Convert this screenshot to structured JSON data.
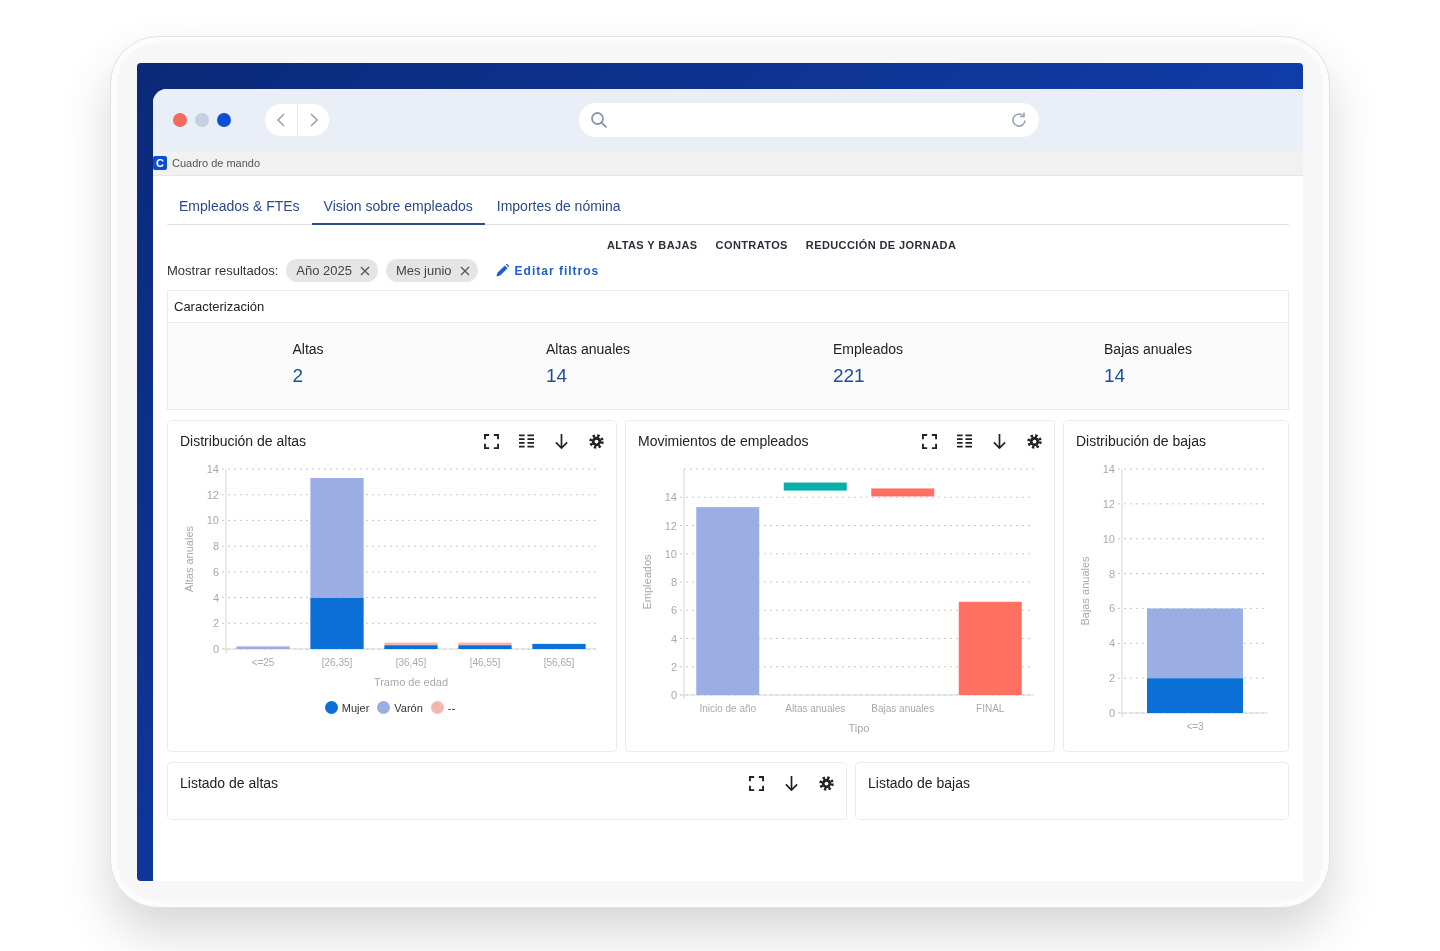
{
  "browser": {
    "tab": {
      "logo": "C",
      "title": "Cuadro de mando"
    }
  },
  "tabs": [
    {
      "label": "Empleados & FTEs",
      "selected": false
    },
    {
      "label": "Vision sobre empleados",
      "selected": true
    },
    {
      "label": "Importes de nómina",
      "selected": false
    }
  ],
  "section_tabs": [
    "ALTAS Y BAJAS",
    "CONTRATOS",
    "REDUCCIÓN DE JORNADA"
  ],
  "filters": {
    "label": "Mostrar resultados:",
    "chips": [
      "Año 2025",
      "Mes junio"
    ],
    "edit_link": "Editar filtros"
  },
  "characterization": {
    "title": "Caracterización",
    "kpis": [
      {
        "label": "Altas",
        "value": "2"
      },
      {
        "label": "Altas anuales",
        "value": "14"
      },
      {
        "label": "Empleados",
        "value": "221"
      },
      {
        "label": "Bajas anuales",
        "value": "14"
      }
    ]
  },
  "charts": [
    {
      "kind": "bar",
      "title": "Distribución de altas",
      "tools": [
        {
          "kind": "expand"
        },
        {
          "kind": "table"
        },
        {
          "kind": "download"
        },
        {
          "kind": "settings"
        }
      ],
      "chart_data": {
        "type": "bar",
        "stacked": true,
        "grid": true,
        "xlabel": "Tramo de edad",
        "ylabel": "Altas anuales",
        "categories": [
          "<=25",
          "[26,35]",
          "[36,45]",
          "[46,55]",
          "[56,65]"
        ],
        "series": [
          {
            "name": "Mujer",
            "color": "#0b6fd8",
            "values": [
              0,
              4,
              0.3,
              0.3,
              0.4
            ]
          },
          {
            "name": "Varón",
            "color": "#9aaee3",
            "values": [
              0.2,
              9.3,
              0,
              0,
              0
            ]
          },
          {
            "name": "--",
            "color": "#f2b8b0",
            "values": [
              0,
              0,
              0.2,
              0.2,
              0
            ]
          }
        ],
        "ylim": [
          0,
          14
        ],
        "yticks": [
          0,
          2,
          4,
          6,
          8,
          10,
          12,
          14
        ]
      }
    },
    {
      "kind": "waterfall",
      "title": "Movimientos de empleados",
      "tools": [
        {
          "kind": "expand"
        },
        {
          "kind": "table"
        },
        {
          "kind": "download"
        },
        {
          "kind": "settings"
        }
      ],
      "chart_data": {
        "type": "bar",
        "grid": true,
        "xlabel": "Tipo",
        "ylabel": "Empleados",
        "categories": [
          "Inicio de año",
          "Altas anuales",
          "Bajas anuales",
          "FINAL"
        ],
        "series": [
          {
            "color": "#9aaee3",
            "values": [
              13.3,
              null,
              null,
              null
            ]
          },
          {
            "color": "#ff7063",
            "values": [
              null,
              null,
              null,
              6.6
            ]
          }
        ],
        "ylim": [
          0,
          16
        ],
        "yticks": [
          0,
          2,
          4,
          6,
          8,
          10,
          12,
          14
        ]
      }
    },
    {
      "kind": "bar",
      "title": "Distribución de bajas",
      "chart_data": {
        "type": "bar",
        "stacked": true,
        "grid": true,
        "ylabel": "Bajas anuales",
        "categories": [
          "<=3"
        ],
        "series": [
          {
            "color": "#0b6fd8",
            "values": [
              2
            ]
          },
          {
            "color": "#9aaee3",
            "values": [
              4
            ]
          }
        ],
        "ylim": [
          0,
          14
        ],
        "yticks": [
          0,
          2,
          4,
          6,
          8,
          10,
          12,
          14
        ]
      }
    }
  ],
  "lists": [
    {
      "title": "Listado de altas",
      "tools": [
        {
          "kind": "expand"
        },
        {
          "kind": "download"
        },
        {
          "kind": "settings"
        }
      ]
    },
    {
      "title": "Listado de bajas"
    }
  ]
}
